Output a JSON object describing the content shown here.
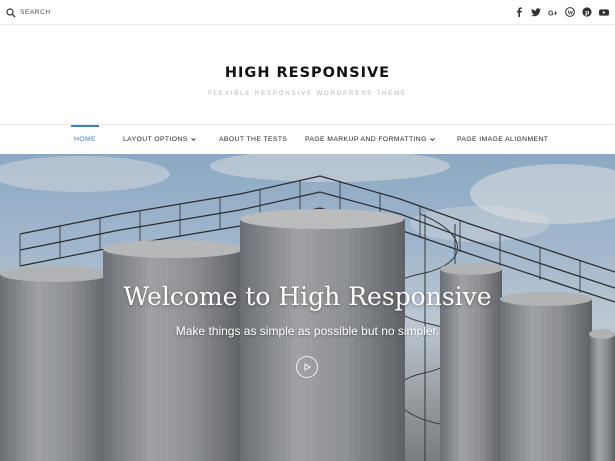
{
  "topbar": {
    "search_label": "SEARCH",
    "social_icons": [
      "facebook-icon",
      "twitter-icon",
      "google-plus-icon",
      "wordpress-icon",
      "pinterest-icon",
      "youtube-icon"
    ]
  },
  "branding": {
    "title": "HIGH RESPONSIVE",
    "description": "FLEXIBLE RESPONSIVE WORDPRESS THEME"
  },
  "nav": {
    "items": [
      {
        "label": "HOME",
        "active": true,
        "has_dropdown": false
      },
      {
        "label": "LAYOUT OPTIONS",
        "active": false,
        "has_dropdown": true
      },
      {
        "label": "ABOUT THE TESTS",
        "active": false,
        "has_dropdown": false
      },
      {
        "label": "PAGE MARKUP AND FORMATTING",
        "active": false,
        "has_dropdown": true
      },
      {
        "label": "PAGE IMAGE ALIGNMENT",
        "active": false,
        "has_dropdown": false
      }
    ]
  },
  "hero": {
    "title": "Welcome to High Responsive",
    "subtitle": "Make things as simple as possible but no simpler."
  },
  "colors": {
    "accent": "#3e7fc2",
    "title": "#111111",
    "muted": "#b4b4b4"
  }
}
